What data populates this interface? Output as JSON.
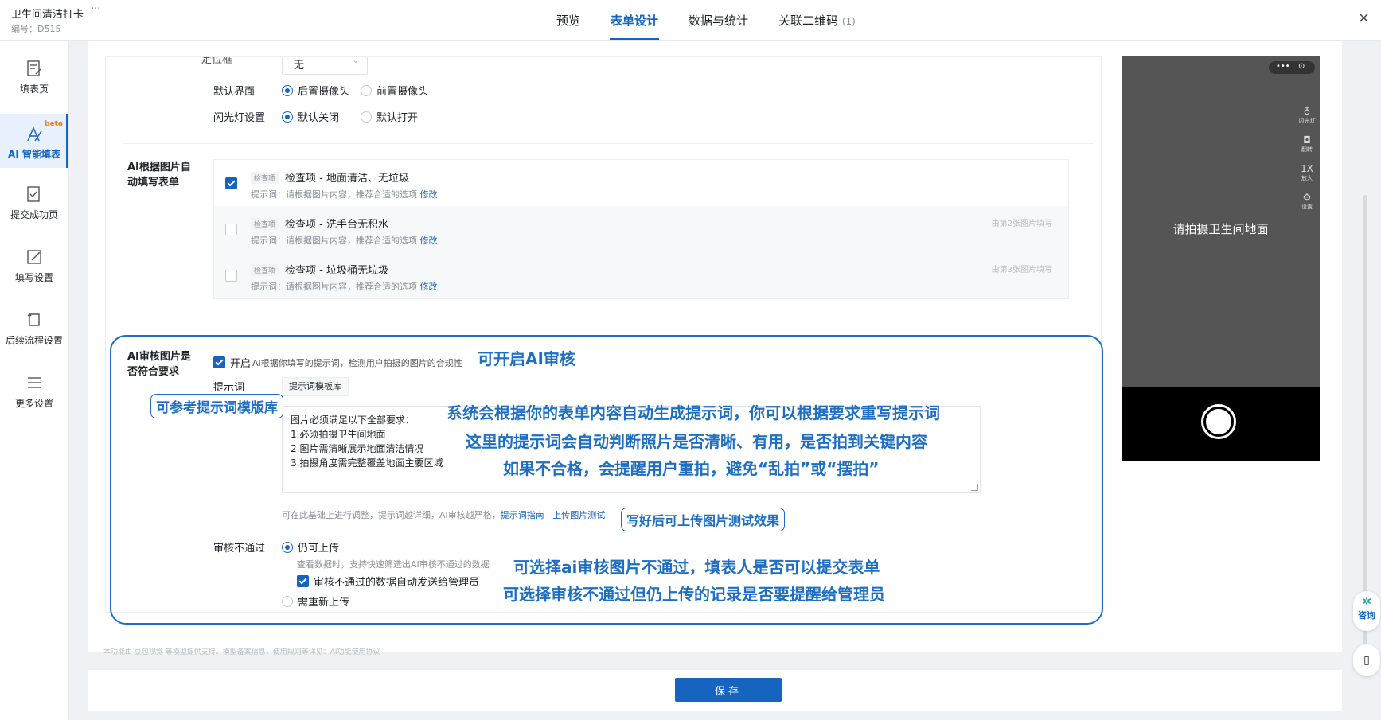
{
  "header": {
    "title": "卫生间清洁打卡",
    "more": "···",
    "id_label": "编号：D515",
    "tabs": [
      {
        "label": "预览",
        "count": ""
      },
      {
        "label": "表单设计",
        "count": ""
      },
      {
        "label": "数据与统计",
        "count": ""
      },
      {
        "label": "关联二维码",
        "count": "(1)"
      }
    ],
    "close": "×"
  },
  "sidebar": {
    "items": [
      {
        "label": "填表页",
        "icon": "form-page-icon"
      },
      {
        "label": "AI 智能填表",
        "icon": "ai-fill-icon",
        "badge": "beta"
      },
      {
        "label": "提交成功页",
        "icon": "submit-success-icon"
      },
      {
        "label": "填写设置",
        "icon": "fill-settings-icon"
      },
      {
        "label": "后续流程设置",
        "icon": "workflow-icon"
      },
      {
        "label": "更多设置",
        "icon": "more-settings-icon"
      }
    ]
  },
  "form": {
    "cut_label": "定位框",
    "cut_value": "无",
    "default_view": {
      "label": "默认界面",
      "opt1": "后置摄像头",
      "opt2": "前置摄像头"
    },
    "flash": {
      "label": "闪光灯设置",
      "opt1": "默认关闭",
      "opt2": "默认打开"
    },
    "ai_fill": {
      "label": "AI根据图片自动填写表单",
      "tag": "检查项",
      "hint_prefix": "提示词：请根据图片内容，推荐合适的选项",
      "edit": "修改",
      "items": [
        {
          "title": "检查项 - 地面清洁、无垃圾",
          "right": ""
        },
        {
          "title": "检查项 - 洗手台无积水",
          "right": "由第2张图片填写"
        },
        {
          "title": "检查项 - 垃圾桶无垃圾",
          "right": "由第3张图片填写"
        }
      ]
    },
    "ai_review": {
      "label": "AI审核图片是否符合要求",
      "enable_label": "开启",
      "enable_desc": "AI根据你填写的提示词，检测用户拍摄的图片的合规性",
      "prompt_label": "提示词",
      "template_button": "提示词模板库",
      "prompt_text": "图片必须满足以下全部要求：\n1.必须拍摄卫生间地面\n2.图片需清晰展示地面清洁情况\n3.拍摄角度需完整覆盖地面主要区域",
      "prompt_note": "可在此基础上进行调整，提示词越详细，AI审核越严格，",
      "guide_link": "提示词指南",
      "upload_test_link": "上传图片测试",
      "fail_label": "审核不通过",
      "fail_opt1": "仍可上传",
      "fail_opt1_desc": "查看数据时，支持快速筛选出AI审核不通过的数据",
      "fail_notify": "审核不通过的数据自动发送给管理员",
      "fail_opt2": "需重新上传"
    }
  },
  "annotations": {
    "a1": "可开启AI审核",
    "a2": "可参考提示词模版库",
    "a3_line1": "系统会根据你的表单内容自动生成提示词，你可以根据要求重写提示词",
    "a3_line2": "这里的提示词会自动判断照片是否清晰、有用，是否拍到关键内容",
    "a3_line3": "如果不合格，会提醒用户重拍，避免“乱拍”或“摆拍”",
    "a4": "写好后可上传图片测试效果",
    "a5_line1": "可选择ai审核图片不通过，填表人是否可以提交表单",
    "a5_line2": "可选择审核不通过但仍上传的记录是否要提醒给管理员"
  },
  "phone": {
    "top_more": "•••",
    "top_target": "⊙",
    "tools": [
      {
        "glyph": "♁",
        "label": "闪光灯"
      },
      {
        "glyph": "◘",
        "label": "翻转"
      },
      {
        "glyph": "1X",
        "label": "放大"
      },
      {
        "glyph": "⚙",
        "label": "设置"
      }
    ],
    "prompt": "请拍摄卫生间地面"
  },
  "float": {
    "consult": "咨询"
  },
  "footer_note": "本功能由 豆包视觉 等模型提供支持。模型备案信息，使用规则等详见：AI功能使用协议",
  "save_button": "保存"
}
